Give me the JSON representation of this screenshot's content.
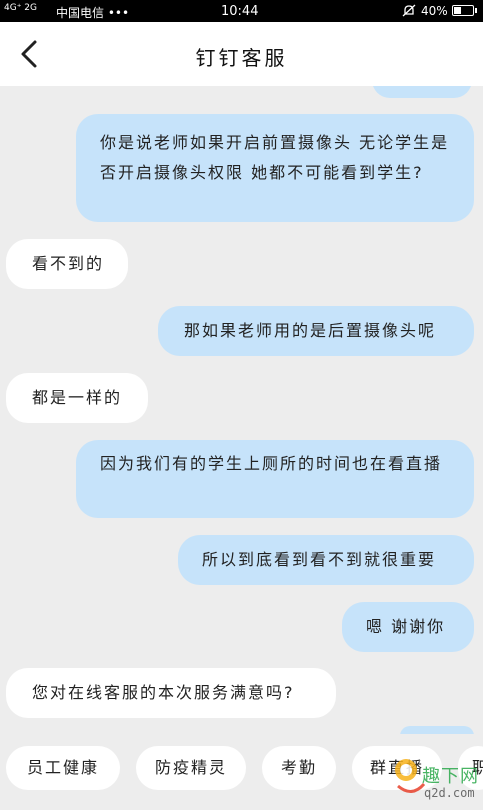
{
  "status_bar": {
    "signal": "4G⁺ 2G",
    "carrier": "中国电信 •••",
    "time": "10:44",
    "battery_pct": "40%",
    "battery_level": 0.4
  },
  "nav": {
    "back_icon": "chevron-left-icon",
    "title": "钉钉客服"
  },
  "messages": [
    {
      "side": "right",
      "text": "你是说老师如果开启前置摄像头 无论学生是否开启摄像头权限 她都不可能看到学生?"
    },
    {
      "side": "left",
      "text": "看不到的"
    },
    {
      "side": "right",
      "text": "那如果老师用的是后置摄像头呢"
    },
    {
      "side": "left",
      "text": "都是一样的"
    },
    {
      "side": "right",
      "text": "因为我们有的学生上厕所的时间也在看直播"
    },
    {
      "side": "right",
      "text": "所以到底看到看不到就很重要"
    },
    {
      "side": "right",
      "text": "嗯 谢谢你"
    },
    {
      "side": "left",
      "text": "您对在线客服的本次服务满意吗?"
    }
  ],
  "quick_replies": [
    "员工健康",
    "防疫精灵",
    "考勤",
    "群直播",
    "职"
  ],
  "watermark": {
    "line1": "趣下网",
    "line2": "q2d.com"
  },
  "colors": {
    "my_bubble": "#c6e3fa",
    "agent_bubble": "#ffffff",
    "background": "#ededed"
  }
}
